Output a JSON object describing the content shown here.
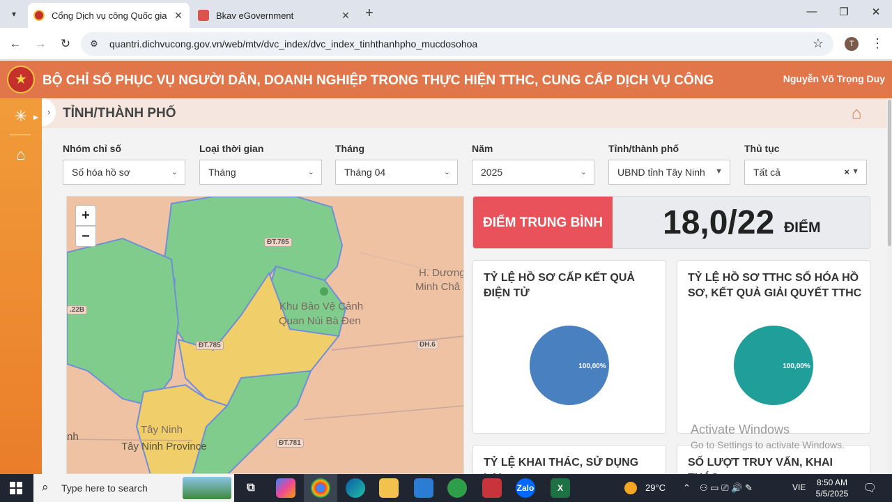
{
  "browser": {
    "tabs": [
      {
        "title": "Cổng Dịch vụ công Quốc gia",
        "active": true
      },
      {
        "title": "Bkav eGovernment",
        "active": false
      }
    ],
    "url": "quantri.dichvucong.gov.vn/web/mtv/dvc_index/dvc_index_tinhthanhpho_mucdosohoa",
    "profile_initial": "T"
  },
  "header": {
    "title": "BỘ CHỈ SỐ PHỤC VỤ NGƯỜI DÂN, DOANH NGHIỆP TRONG THỰC HIỆN TTHC, CUNG CẤP DỊCH VỤ CÔNG",
    "user": "Nguyễn Võ Trọng Duy",
    "color": "#e0764a"
  },
  "page": {
    "title": "TỈNH/THÀNH PHỐ"
  },
  "filters": [
    {
      "label": "Nhóm chỉ số",
      "value": "Số hóa hồ sơ"
    },
    {
      "label": "Loại thời gian",
      "value": "Tháng"
    },
    {
      "label": "Tháng",
      "value": "Tháng 04"
    },
    {
      "label": "Năm",
      "value": "2025"
    },
    {
      "label": "Tỉnh/thành phố",
      "value": "UBND tỉnh Tây Ninh"
    },
    {
      "label": "Thủ tục",
      "value": "Tất cả"
    }
  ],
  "map": {
    "zoom_in": "+",
    "zoom_out": "−",
    "labels": {
      "place1": "H. Dương",
      "place2": "Minh Châ",
      "park1": "Khu Bảo Vệ Cảnh",
      "park2": "Quan Núi Bà Đen",
      "city1": "Tây Ninh",
      "city2": "Tây Ninh Province",
      "edge1": "nh"
    },
    "roads": {
      "r1": "ĐT.785",
      "r2": "ĐT.785",
      "r3": "ĐH.6",
      "r4": "ĐT.781",
      "r5": ".22B"
    }
  },
  "score": {
    "label": "ĐIỂM TRUNG BÌNH",
    "value": "18,0/22",
    "unit": "ĐIỂM",
    "accent": "#e9525a"
  },
  "cards": [
    {
      "title": "TỶ LỆ HỒ SƠ CẤP KẾT QUẢ ĐIỆN TỬ",
      "pie_label": "100,00%",
      "color": "#4880c0"
    },
    {
      "title": "TỶ LỆ HỒ SƠ TTHC SỐ HÓA HỒ SƠ, KẾT QUẢ GIẢI QUYẾT TTHC",
      "pie_label": "100,00%",
      "color": "#1f9e9a"
    },
    {
      "title": "TỶ LỆ KHAI THÁC, SỬ DỤNG LẠI"
    },
    {
      "title": "SỐ LƯỢT TRUY VẤN, KHAI THÁC"
    }
  ],
  "watermark": {
    "line1": "Activate Windows",
    "line2": "Go to Settings to activate Windows."
  },
  "taskbar": {
    "search_placeholder": "Type here to search",
    "weather": "29°C",
    "lang": "VIE",
    "time": "8:50 AM",
    "date": "5/5/2025"
  }
}
